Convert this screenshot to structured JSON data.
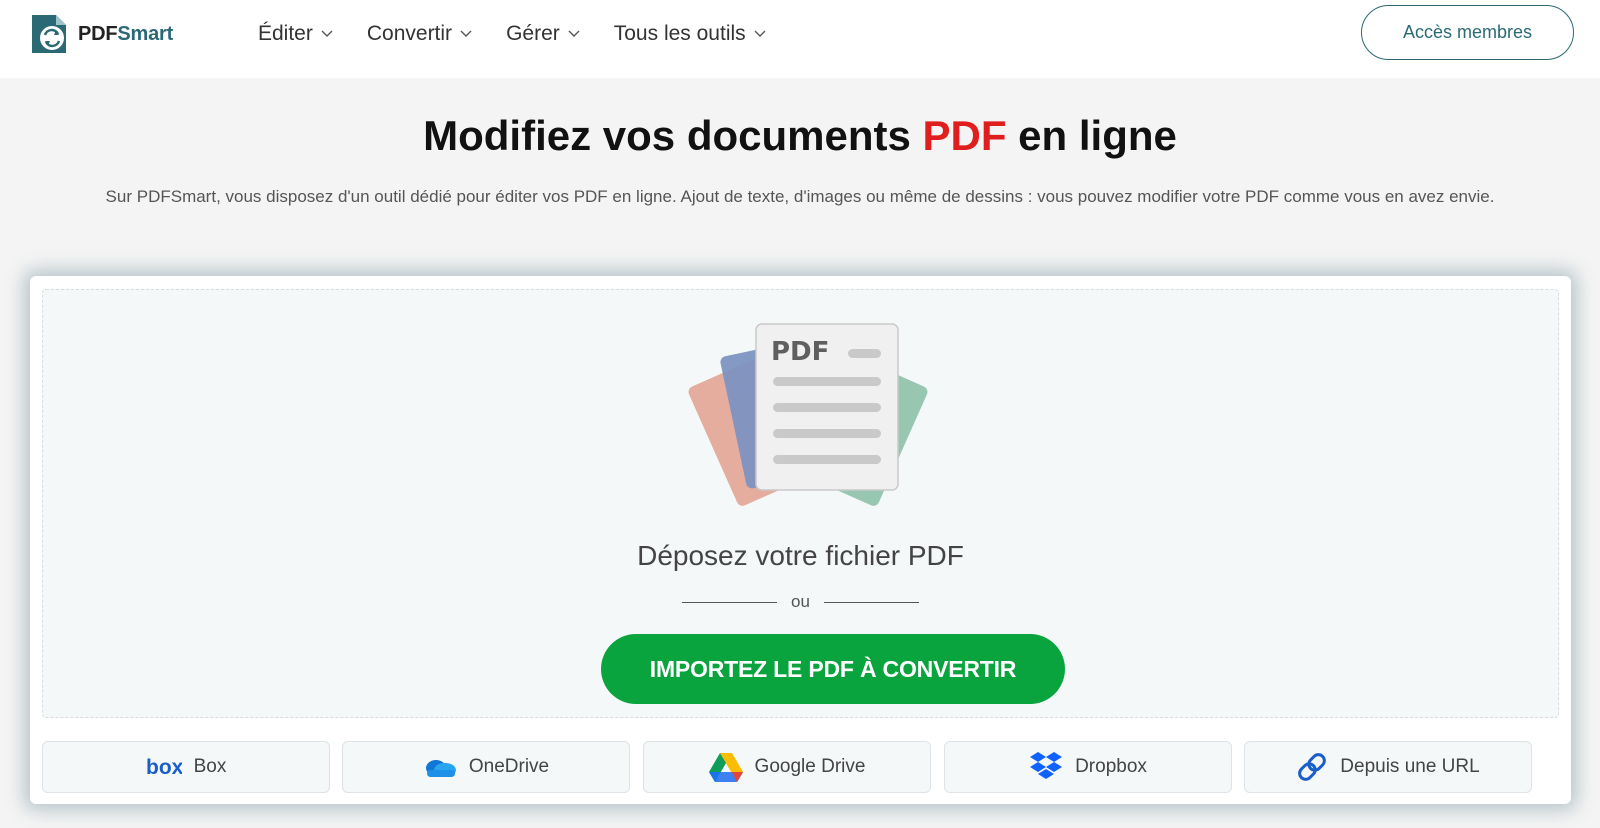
{
  "brand": {
    "name_part1": "PDF",
    "name_part2": "Smart"
  },
  "nav": {
    "items": [
      {
        "label": "Éditer"
      },
      {
        "label": "Convertir"
      },
      {
        "label": "Gérer"
      },
      {
        "label": "Tous les outils"
      }
    ],
    "member_button": "Accès membres"
  },
  "hero": {
    "title_part1": "Modifiez vos documents ",
    "title_accent": "PDF",
    "title_part2": " en ligne",
    "subtitle": "Sur PDFSmart, vous disposez d'un outil dédié pour éditer vos PDF en ligne. Ajout de texte, d'images ou même de dessins : vous pouvez modifier votre PDF comme vous en avez envie."
  },
  "upload": {
    "doc_label": "PDF",
    "drop_text": "Déposez votre fichier PDF",
    "or_text": "ou",
    "import_button": "IMPORTEZ LE PDF À CONVERTIR",
    "sources": [
      {
        "label": "Box",
        "icon": "box-icon"
      },
      {
        "label": "OneDrive",
        "icon": "onedrive-icon"
      },
      {
        "label": "Google Drive",
        "icon": "google-drive-icon"
      },
      {
        "label": "Dropbox",
        "icon": "dropbox-icon"
      },
      {
        "label": "Depuis une URL",
        "icon": "link-icon"
      }
    ]
  },
  "colors": {
    "brand_teal": "#2b6a74",
    "accent_red": "#e01e1e",
    "cta_green": "#09a43d"
  }
}
